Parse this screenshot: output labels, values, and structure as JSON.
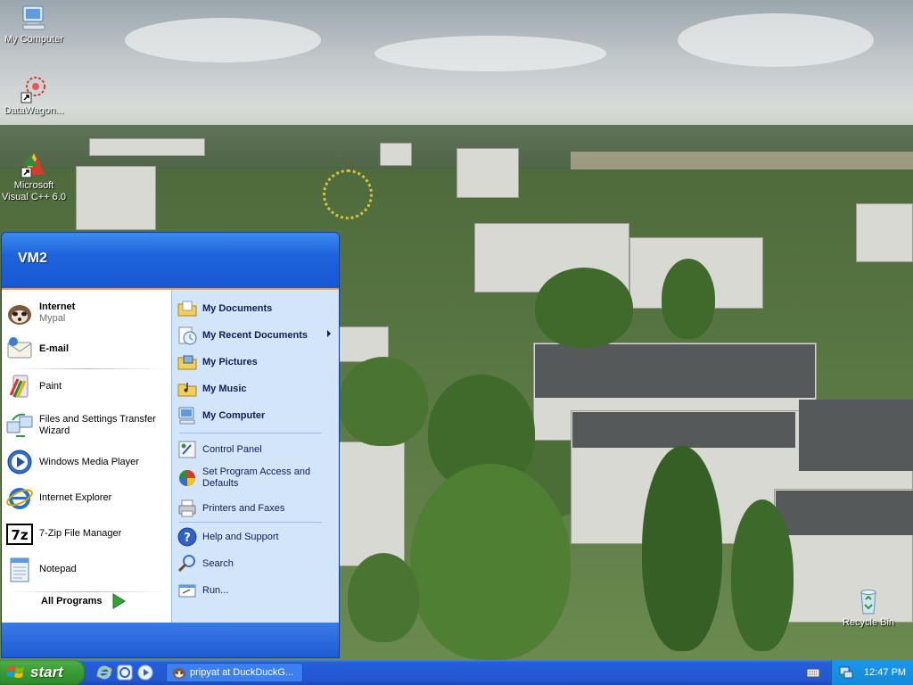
{
  "desktop": {
    "icons": [
      {
        "label": "My Computer",
        "icon": "my-computer-icon"
      },
      {
        "label": "DataWagon...",
        "icon": "shortcut-flower-icon"
      },
      {
        "label": "Microsoft Visual C++ 6.0",
        "icon": "visual-cpp-icon"
      },
      {
        "label": "Recycle Bin",
        "icon": "recycle-bin-icon"
      }
    ]
  },
  "start_menu": {
    "user_name": "VM2",
    "pinned": [
      {
        "title": "Internet",
        "subtitle": "Mypal",
        "icon": "mypal-browser-icon"
      },
      {
        "title": "E-mail",
        "icon": "email-icon"
      }
    ],
    "recent": [
      {
        "label": "Paint",
        "icon": "paint-icon"
      },
      {
        "label": "Files and Settings Transfer Wizard",
        "icon": "transfer-wizard-icon"
      },
      {
        "label": "Windows Media Player",
        "icon": "media-player-icon"
      },
      {
        "label": "Internet Explorer",
        "icon": "internet-explorer-icon"
      },
      {
        "label": "7-Zip File Manager",
        "icon": "seven-zip-icon"
      },
      {
        "label": "Notepad",
        "icon": "notepad-icon"
      }
    ],
    "all_programs_label": "All Programs",
    "places": [
      {
        "label": "My Documents",
        "icon": "my-documents-icon"
      },
      {
        "label": "My Recent Documents",
        "icon": "recent-documents-icon"
      },
      {
        "label": "My Pictures",
        "icon": "my-pictures-icon"
      },
      {
        "label": "My Music",
        "icon": "my-music-icon"
      },
      {
        "label": "My Computer",
        "icon": "my-computer-icon"
      }
    ],
    "settings": [
      {
        "label": "Control Panel",
        "icon": "control-panel-icon"
      },
      {
        "label": "Set Program Access and Defaults",
        "icon": "program-access-icon"
      },
      {
        "label": "Printers and Faxes",
        "icon": "printer-icon"
      }
    ],
    "support": [
      {
        "label": "Help and Support",
        "icon": "help-icon"
      },
      {
        "label": "Search",
        "icon": "search-icon"
      },
      {
        "label": "Run...",
        "icon": "run-icon"
      }
    ]
  },
  "taskbar": {
    "start_label": "start",
    "quick_launch": [
      "internet-explorer-icon",
      "mypal-browser-icon",
      "media-player-icon"
    ],
    "task_button_label": "pripyat at DuckDuckG...",
    "clock": "12:47 PM"
  },
  "colors": {
    "start_menu_blue": "#1b5bd6",
    "start_green": "#3c9e36",
    "taskbar_blue": "#2457d0",
    "tray_blue": "#138ad9"
  }
}
